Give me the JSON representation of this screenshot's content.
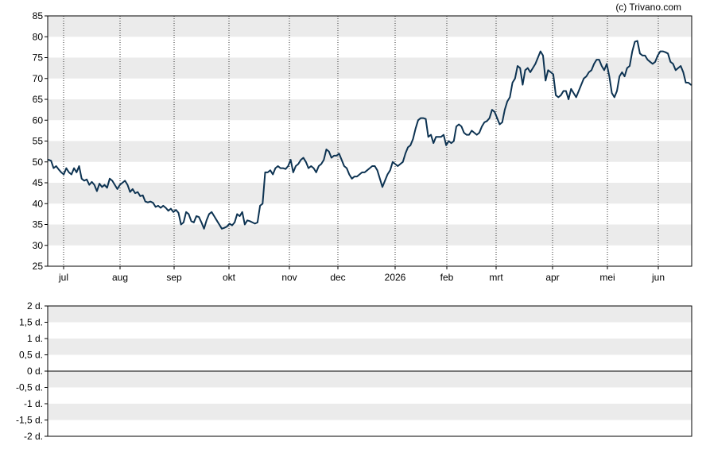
{
  "copyright": "(c) Trivano.com",
  "colors": {
    "line": "#0d3352",
    "band": "#ebebeb",
    "frame": "#000000",
    "vgrid": "#333333"
  },
  "chart_data": [
    {
      "type": "line",
      "ylim": [
        25,
        85
      ],
      "y_ticks": [
        "25",
        "30",
        "35",
        "40",
        "45",
        "50",
        "55",
        "60",
        "65",
        "70",
        "75",
        "80",
        "85"
      ],
      "x_ticks": [
        "jul",
        "aug",
        "sep",
        "okt",
        "nov",
        "dec",
        "2026",
        "feb",
        "mrt",
        "apr",
        "mei",
        "jun"
      ],
      "grid": "alternating horizontal bands, dotted vertical lines at month ticks",
      "series": [
        {
          "values": [
            50.5,
            50.3,
            48.5,
            49.0,
            48.2,
            47.5,
            47.0,
            48.5,
            47.5,
            47.0,
            48.5,
            47.5,
            49.0,
            46.0,
            45.5,
            45.8,
            44.5,
            45.2,
            44.5,
            43.0,
            44.8,
            44.0,
            44.5,
            43.8,
            46.0,
            45.5,
            44.5,
            43.5,
            44.5,
            45.0,
            45.5,
            44.5,
            42.8,
            43.5,
            42.5,
            42.8,
            41.8,
            42.0,
            40.5,
            40.3,
            40.5,
            40.2,
            39.2,
            39.5,
            39.0,
            39.5,
            39.0,
            38.3,
            38.8,
            38.0,
            38.5,
            37.8,
            35.0,
            35.5,
            38.0,
            37.5,
            35.8,
            35.5,
            37.0,
            36.8,
            35.5,
            34.0,
            36.0,
            37.5,
            38.0,
            37.0,
            36.0,
            35.0,
            34.0,
            34.2,
            34.5,
            35.2,
            34.8,
            35.5,
            37.5,
            37.0,
            38.0,
            35.0,
            36.0,
            35.8,
            35.5,
            35.2,
            35.5,
            39.5,
            40.0,
            47.5,
            47.5,
            48.0,
            47.0,
            48.5,
            49.0,
            48.5,
            48.5,
            48.3,
            49.0,
            50.5,
            47.5,
            49.0,
            49.5,
            50.5,
            51.0,
            50.0,
            48.5,
            49.0,
            48.5,
            47.5,
            49.0,
            49.5,
            50.5,
            53.0,
            52.5,
            51.0,
            51.5,
            51.5,
            52.0,
            50.5,
            49.0,
            48.5,
            47.0,
            46.0,
            46.5,
            46.5,
            47.0,
            47.5,
            47.5,
            48.0,
            48.5,
            49.0,
            49.0,
            48.0,
            46.0,
            44.0,
            45.5,
            47.0,
            48.0,
            50.0,
            49.5,
            49.0,
            49.5,
            50.0,
            52.0,
            53.5,
            54.0,
            55.5,
            58.0,
            60.0,
            60.5,
            60.5,
            60.3,
            56.0,
            56.5,
            54.5,
            56.0,
            56.0,
            56.0,
            56.5,
            54.0,
            55.0,
            54.5,
            55.0,
            58.5,
            59.0,
            58.5,
            57.0,
            56.5,
            56.5,
            57.5,
            57.0,
            56.5,
            57.0,
            58.5,
            59.5,
            59.8,
            60.5,
            62.5,
            62.0,
            60.5,
            59.0,
            59.5,
            62.5,
            64.5,
            65.5,
            69.0,
            70.0,
            73.0,
            72.5,
            68.5,
            72.0,
            72.5,
            71.5,
            72.5,
            73.5,
            75.0,
            76.5,
            75.5,
            69.5,
            72.0,
            71.5,
            71.0,
            66.0,
            65.5,
            66.0,
            67.0,
            67.0,
            65.0,
            67.5,
            66.5,
            65.5,
            67.0,
            68.5,
            70.0,
            70.5,
            71.5,
            72.0,
            73.5,
            74.5,
            74.5,
            73.0,
            72.0,
            73.5,
            70.5,
            66.5,
            65.5,
            67.0,
            70.5,
            71.5,
            70.5,
            72.5,
            73.0,
            76.5,
            78.8,
            79.0,
            76.0,
            75.5,
            75.5,
            74.5,
            74.0,
            73.5,
            74.0,
            75.5,
            76.5,
            76.5,
            76.3,
            76.0,
            74.0,
            73.5,
            72.0,
            72.5,
            73.0,
            71.5,
            69.0,
            69.0,
            68.5
          ]
        }
      ]
    },
    {
      "type": "line",
      "ylim": [
        -2,
        2
      ],
      "y_ticks": [
        "2 d.",
        "1,5 d.",
        "1 d.",
        "0,5 d.",
        "0 d.",
        "-0,5 d.",
        "-1 d.",
        "-1,5 d.",
        "-2 d."
      ],
      "grid": "alternating horizontal bands, emphasized line at 0 d.",
      "series": []
    }
  ]
}
